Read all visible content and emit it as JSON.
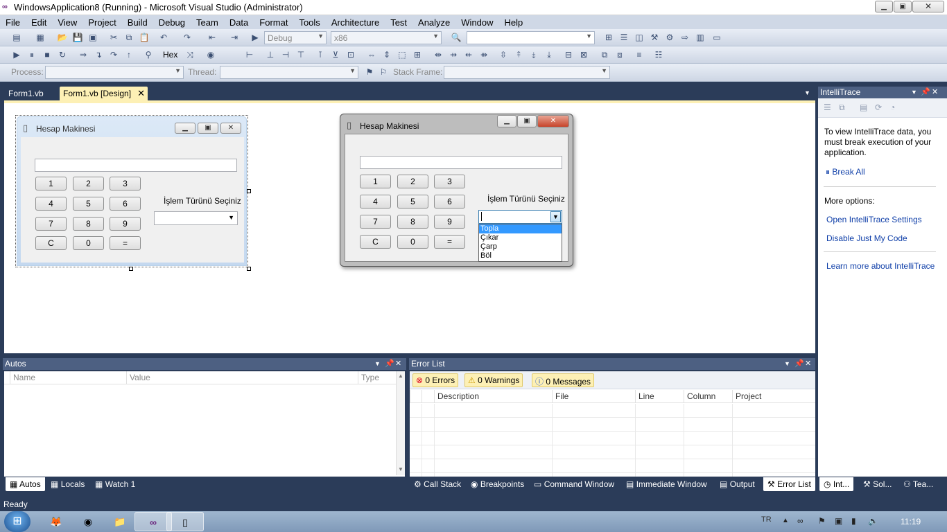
{
  "window": {
    "title": "WindowsApplication8 (Running) - Microsoft Visual Studio (Administrator)"
  },
  "menu": [
    "File",
    "Edit",
    "View",
    "Project",
    "Build",
    "Debug",
    "Team",
    "Data",
    "Format",
    "Tools",
    "Architecture",
    "Test",
    "Analyze",
    "Window",
    "Help"
  ],
  "toolbar": {
    "config": "Debug",
    "platform": "x86",
    "hex_label": "Hex",
    "process_label": "Process:",
    "thread_label": "Thread:",
    "stack_label": "Stack Frame:"
  },
  "tabs": [
    {
      "label": "Form1.vb"
    },
    {
      "label": "Form1.vb [Design]"
    }
  ],
  "form": {
    "title": "Hesap Makinesi",
    "buttons": [
      "1",
      "2",
      "3",
      "4",
      "5",
      "6",
      "7",
      "8",
      "9",
      "C",
      "0",
      "="
    ],
    "label": "İşlem Türünü Seçiniz",
    "options": [
      "Topla",
      "Çıkar",
      "Çarp",
      "Böl"
    ]
  },
  "intellitrace": {
    "title": "IntelliTrace",
    "message": "To view IntelliTrace data, you must break execution of your application.",
    "break_all": "Break All",
    "more_options": "More options:",
    "link1": "Open IntelliTrace Settings",
    "link2": "Disable Just My Code",
    "link3": "Learn more about IntelliTrace"
  },
  "autos": {
    "title": "Autos",
    "columns": [
      "Name",
      "Value",
      "Type"
    ]
  },
  "errors": {
    "title": "Error List",
    "errors": "0 Errors",
    "warnings": "0 Warnings",
    "messages": "0 Messages",
    "columns": [
      "Description",
      "File",
      "Line",
      "Column",
      "Project"
    ]
  },
  "bottom_tabs_left": [
    "Autos",
    "Locals",
    "Watch 1"
  ],
  "bottom_tabs_right": [
    "Call Stack",
    "Breakpoints",
    "Command Window",
    "Immediate Window",
    "Output",
    "Error List"
  ],
  "side_tabs": [
    "Int...",
    "Sol...",
    "Tea..."
  ],
  "status": "Ready",
  "tray": {
    "lang": "TR",
    "time": "11:19"
  }
}
